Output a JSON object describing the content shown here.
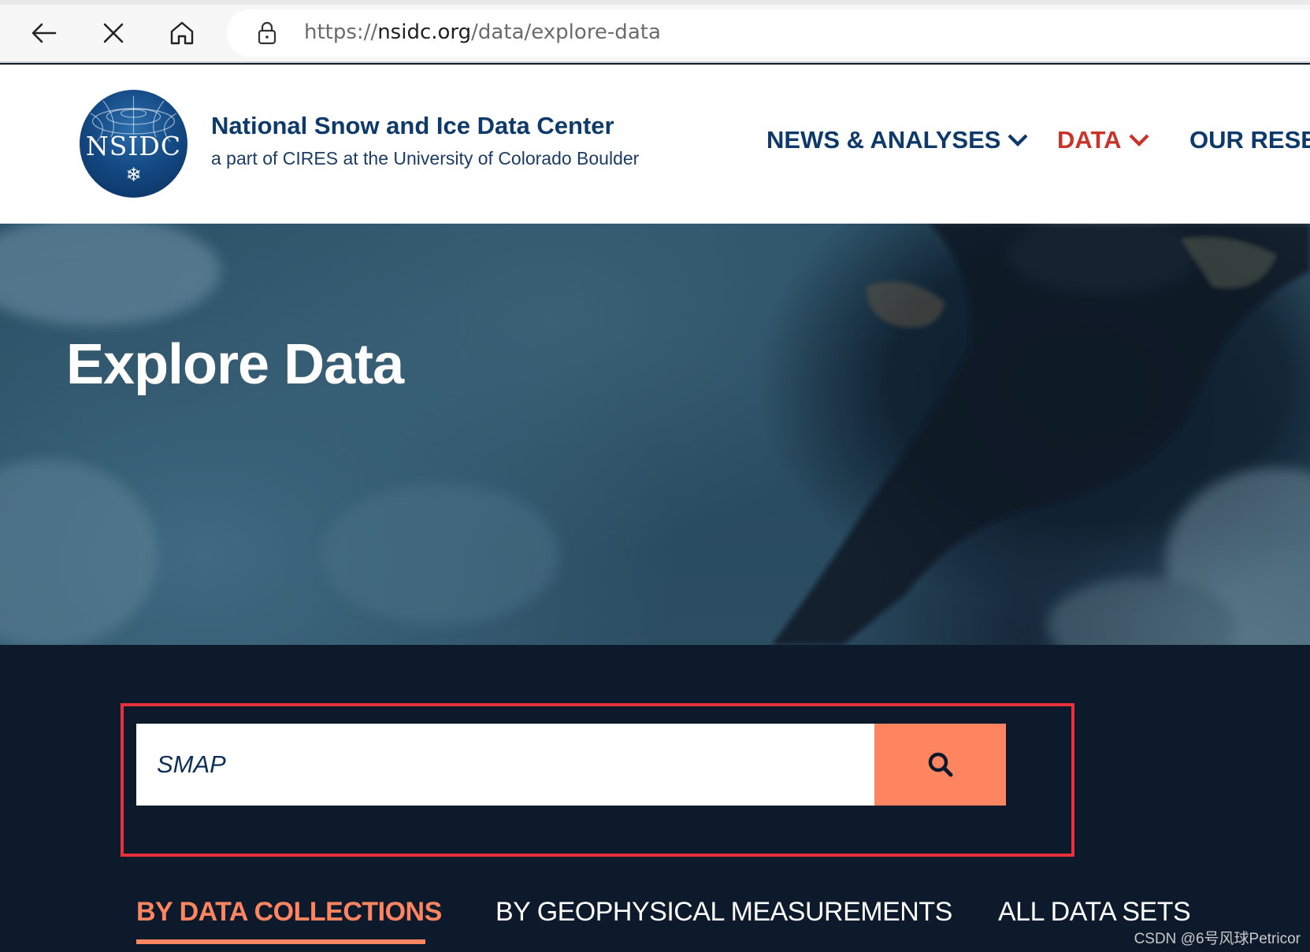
{
  "browser": {
    "url_scheme": "https://",
    "url_host": "nsidc.org",
    "url_path": "/data/explore-data"
  },
  "header": {
    "org_name": "National Snow and Ice Data Center",
    "org_subtitle": "a part of CIRES at the University of Colorado Boulder",
    "logo_text": "NSIDC",
    "logo_glyph": "❄",
    "nav": {
      "news_label": "NEWS & ANALYSES",
      "data_label": "DATA",
      "research_label": "OUR RESEA"
    },
    "colors": {
      "primary": "#0e3a6b",
      "active_nav": "#c9332a"
    }
  },
  "hero": {
    "title": "Explore Data"
  },
  "search": {
    "value": "SMAP",
    "button_icon": "search-icon",
    "accent": "#ff8561"
  },
  "tabs": {
    "collections": "BY DATA COLLECTIONS",
    "geophysical": "BY GEOPHYSICAL MEASUREMENTS",
    "all": "ALL DATA SETS"
  },
  "watermark": "CSDN @6号风球Petricor"
}
